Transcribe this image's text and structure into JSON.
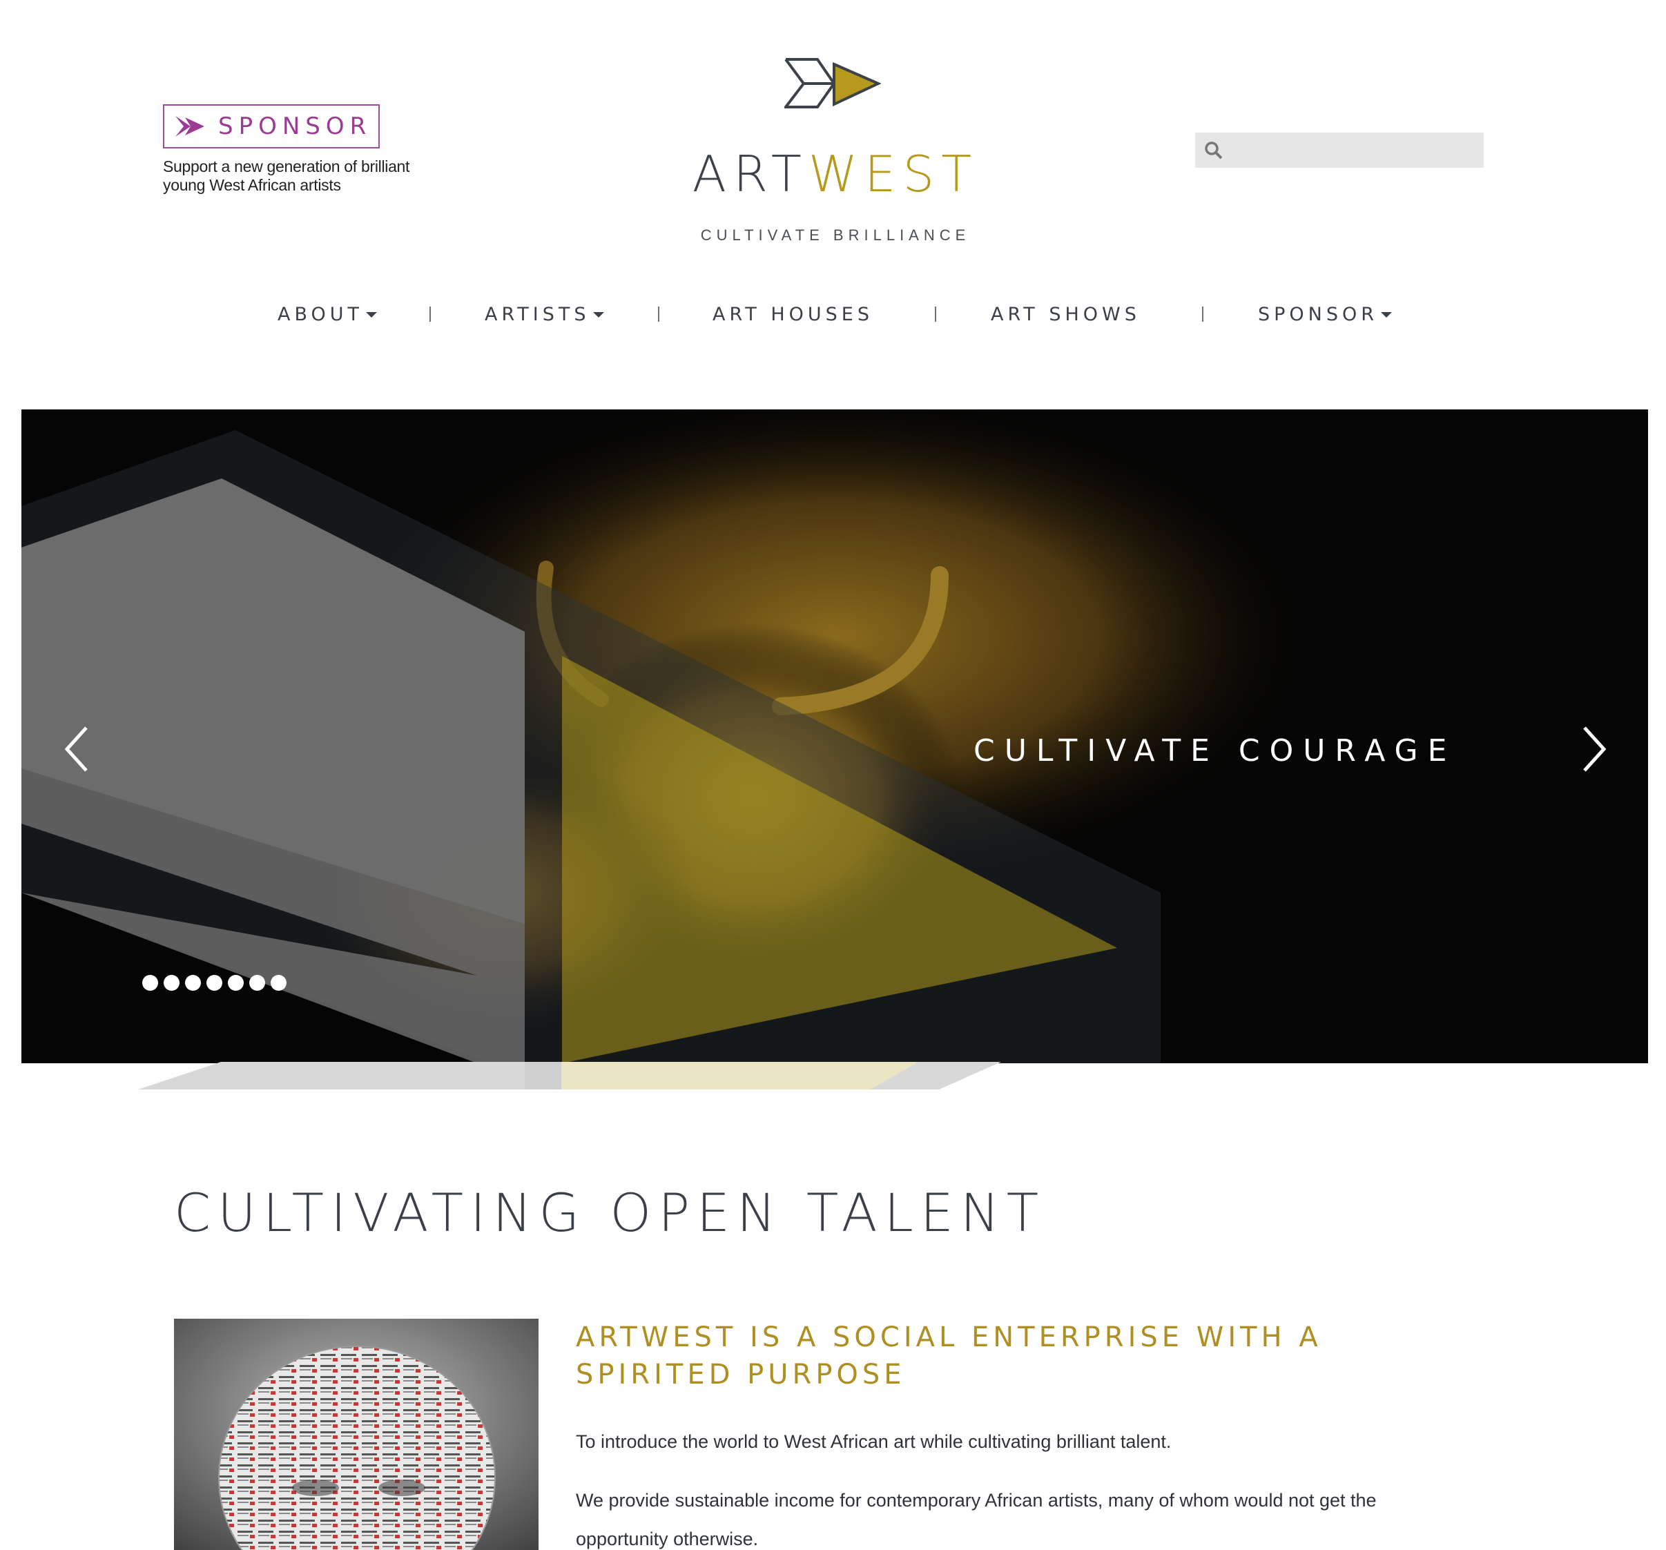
{
  "sponsor": {
    "label": "SPONSOR",
    "description": "Support a new generation of brilliant young West African artists"
  },
  "logo": {
    "art": "ART",
    "west": "WEST",
    "tagline": "CULTIVATE BRILLIANCE"
  },
  "search": {
    "placeholder": "",
    "value": ""
  },
  "nav": {
    "items": [
      {
        "label": "ABOUT",
        "dropdown": true
      },
      {
        "label": "ARTISTS",
        "dropdown": true
      },
      {
        "label": "ART HOUSES",
        "dropdown": false
      },
      {
        "label": "ART SHOWS",
        "dropdown": false
      },
      {
        "label": "SPONSOR",
        "dropdown": true
      }
    ]
  },
  "hero": {
    "title": "CULTIVATE COURAGE",
    "slide_count": 7
  },
  "content": {
    "section_title": "CULTIVATING OPEN TALENT",
    "subtitle": "ARTWEST IS A SOCIAL ENTERPRISE WITH A SPIRITED PURPOSE",
    "paragraph1": "To introduce the world to West African art while cultivating brilliant talent.",
    "paragraph2": "We provide sustainable income for contemporary African artists, many of whom would not get the opportunity otherwise."
  },
  "colors": {
    "brand_gold": "#b59a1d",
    "brand_dark": "#3d4249",
    "sponsor_purple": "#9b3b94",
    "search_bg": "#e6e6e6"
  },
  "icons": {
    "search": "search-icon",
    "prev": "chevron-left-icon",
    "next": "chevron-right-icon",
    "sponsor_arrow": "arrow-mark-icon"
  }
}
